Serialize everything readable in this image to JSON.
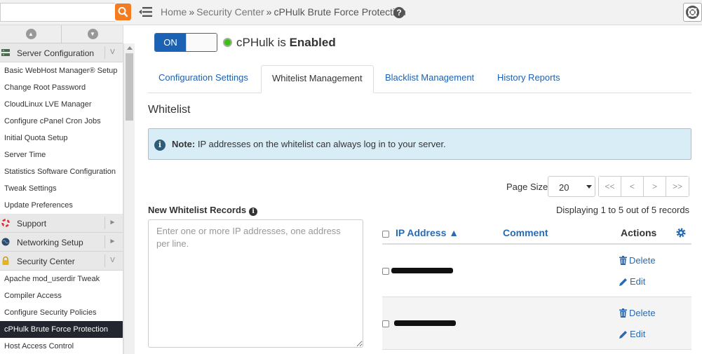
{
  "topbar": {
    "search": {
      "value": "",
      "placeholder": ""
    },
    "breadcrumb": {
      "home": "Home",
      "section": "Security Center",
      "current": "cPHulk Brute Force Protection"
    }
  },
  "sidebar": {
    "server_config": {
      "label": "Server Configuration",
      "items": [
        "Basic WebHost Manager® Setup",
        "Change Root Password",
        "CloudLinux LVE Manager",
        "Configure cPanel Cron Jobs",
        "Initial Quota Setup",
        "Server Time",
        "Statistics Software Configuration",
        "Tweak Settings",
        "Update Preferences"
      ]
    },
    "support": {
      "label": "Support"
    },
    "networking": {
      "label": "Networking Setup"
    },
    "security": {
      "label": "Security Center",
      "items": [
        "Apache mod_userdir Tweak",
        "Compiler Access",
        "Configure Security Policies",
        "cPHulk Brute Force Protection",
        "Host Access Control"
      ]
    }
  },
  "main": {
    "toggle_label": "ON",
    "status_prefix": "cPHulk is ",
    "status_value": "Enabled",
    "tabs": [
      "Configuration Settings",
      "Whitelist Management",
      "Blacklist Management",
      "History Reports"
    ],
    "heading": "Whitelist",
    "note_label": "Note:",
    "note_text": " IP addresses on the whitelist can always log in to your server.",
    "page_size_label": "Page Size",
    "page_size_value": "20",
    "pager": [
      "<<",
      "<",
      ">",
      ">>"
    ],
    "new_records_label": "New Whitelist Records",
    "textarea_placeholder": "Enter one or more IP addresses, one address per line.",
    "displaying": "Displaying 1 to 5 out of 5 records",
    "columns": {
      "ip": "IP Address ▲",
      "comment": "Comment",
      "actions": "Actions"
    },
    "row_actions": {
      "delete": "Delete",
      "edit": "Edit"
    }
  },
  "colors": {
    "accent_blue": "#1b61b4",
    "link": "#2a6ab3",
    "note_bg": "#d9edf7",
    "search_orange": "#f47b20",
    "active_nav": "#23262f",
    "status_green": "#39c30f"
  }
}
